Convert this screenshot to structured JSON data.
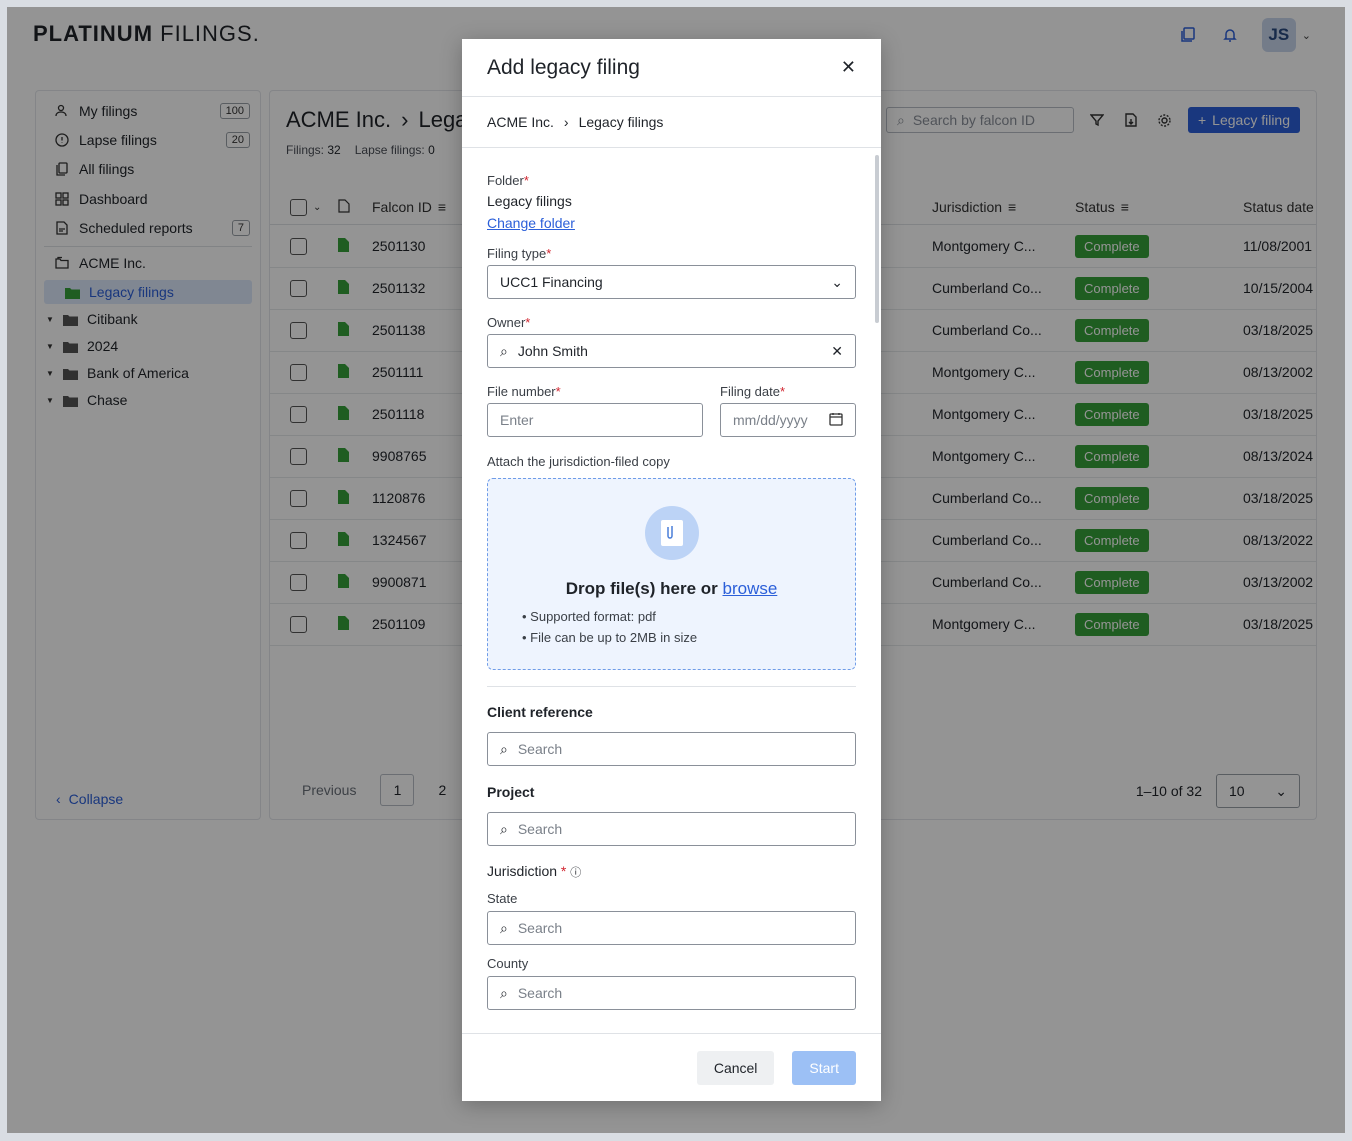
{
  "app": {
    "logo_bold": "PLATINUM",
    "logo_rest": " FILINGS.",
    "avatar": "JS"
  },
  "sidebar": {
    "items": [
      {
        "label": "My filings",
        "count": "100"
      },
      {
        "label": "Lapse filings",
        "count": "20"
      },
      {
        "label": "All filings"
      },
      {
        "label": "Dashboard"
      },
      {
        "label": "Scheduled reports",
        "count": "7"
      }
    ],
    "client": "ACME Inc.",
    "selected": "Legacy filings",
    "folders": [
      "Citibank",
      "2024",
      "Bank of America",
      "Chase"
    ],
    "collapse": "Collapse"
  },
  "main": {
    "crumb_client": "ACME Inc.",
    "crumb_page": "Lega",
    "filings_label": "Filings:",
    "filings_count": "32",
    "lapse_label": "Lapse filings:",
    "lapse_count": "0",
    "search_placeholder": "Search by falcon ID",
    "add_button": "Legacy filing",
    "columns": {
      "falcon": "Falcon ID",
      "jurisdiction": "Jurisdiction",
      "status": "Status",
      "status_date": "Status date"
    },
    "rows": [
      {
        "id": "2501130",
        "jur": "Montgomery C...",
        "status": "Complete",
        "date": "11/08/2001"
      },
      {
        "id": "2501132",
        "jur": "Cumberland Co...",
        "status": "Complete",
        "date": "10/15/2004"
      },
      {
        "id": "2501138",
        "jur": "Cumberland Co...",
        "status": "Complete",
        "date": "03/18/2025"
      },
      {
        "id": "2501111",
        "jur": "Montgomery C...",
        "status": "Complete",
        "date": "08/13/2002"
      },
      {
        "id": "2501118",
        "jur": "Montgomery C...",
        "status": "Complete",
        "date": "03/18/2025"
      },
      {
        "id": "9908765",
        "jur": "Montgomery C...",
        "status": "Complete",
        "date": "08/13/2024"
      },
      {
        "id": "1120876",
        "jur": "Cumberland Co...",
        "status": "Complete",
        "date": "03/18/2025"
      },
      {
        "id": "1324567",
        "jur": "Cumberland Co...",
        "status": "Complete",
        "date": "08/13/2022"
      },
      {
        "id": "9900871",
        "jur": "Cumberland Co...",
        "status": "Complete",
        "date": "03/13/2002"
      },
      {
        "id": "2501109",
        "jur": "Montgomery C...",
        "status": "Complete",
        "date": "03/18/2025"
      }
    ],
    "pager": {
      "previous": "Previous",
      "page1": "1",
      "page2": "2",
      "range": "1–10 of 32",
      "per_page": "10"
    }
  },
  "modal": {
    "title": "Add legacy filing",
    "crumb_client": "ACME Inc.",
    "crumb_folder": "Legacy filings",
    "folder_label": "Folder",
    "folder_value": "Legacy filings",
    "change_folder": "Change folder",
    "filing_type_label": "Filing type",
    "filing_type_value": "UCC1 Financing",
    "owner_label": "Owner",
    "owner_value": "John Smith",
    "file_number_label": "File number",
    "file_number_placeholder": "Enter",
    "filing_date_label": "Filing date",
    "filing_date_placeholder": "mm/dd/yyyy",
    "attach_label": "Attach the jurisdiction-filed copy",
    "drop_text": "Drop file(s) here or ",
    "browse": "browse",
    "drop_note1": "Supported format: pdf",
    "drop_note2": "File can be up to 2MB in size",
    "client_ref_label": "Client reference",
    "client_ref_placeholder": "Search",
    "project_label": "Project",
    "project_placeholder": "Search",
    "jurisdiction_label": "Jurisdiction",
    "state_label": "State",
    "state_placeholder": "Search",
    "county_label": "County",
    "county_placeholder": "Search",
    "cancel": "Cancel",
    "start": "Start"
  },
  "colors": {
    "accent": "#2b5fd9",
    "status_complete": "#36a03a",
    "required": "#d1242f"
  }
}
